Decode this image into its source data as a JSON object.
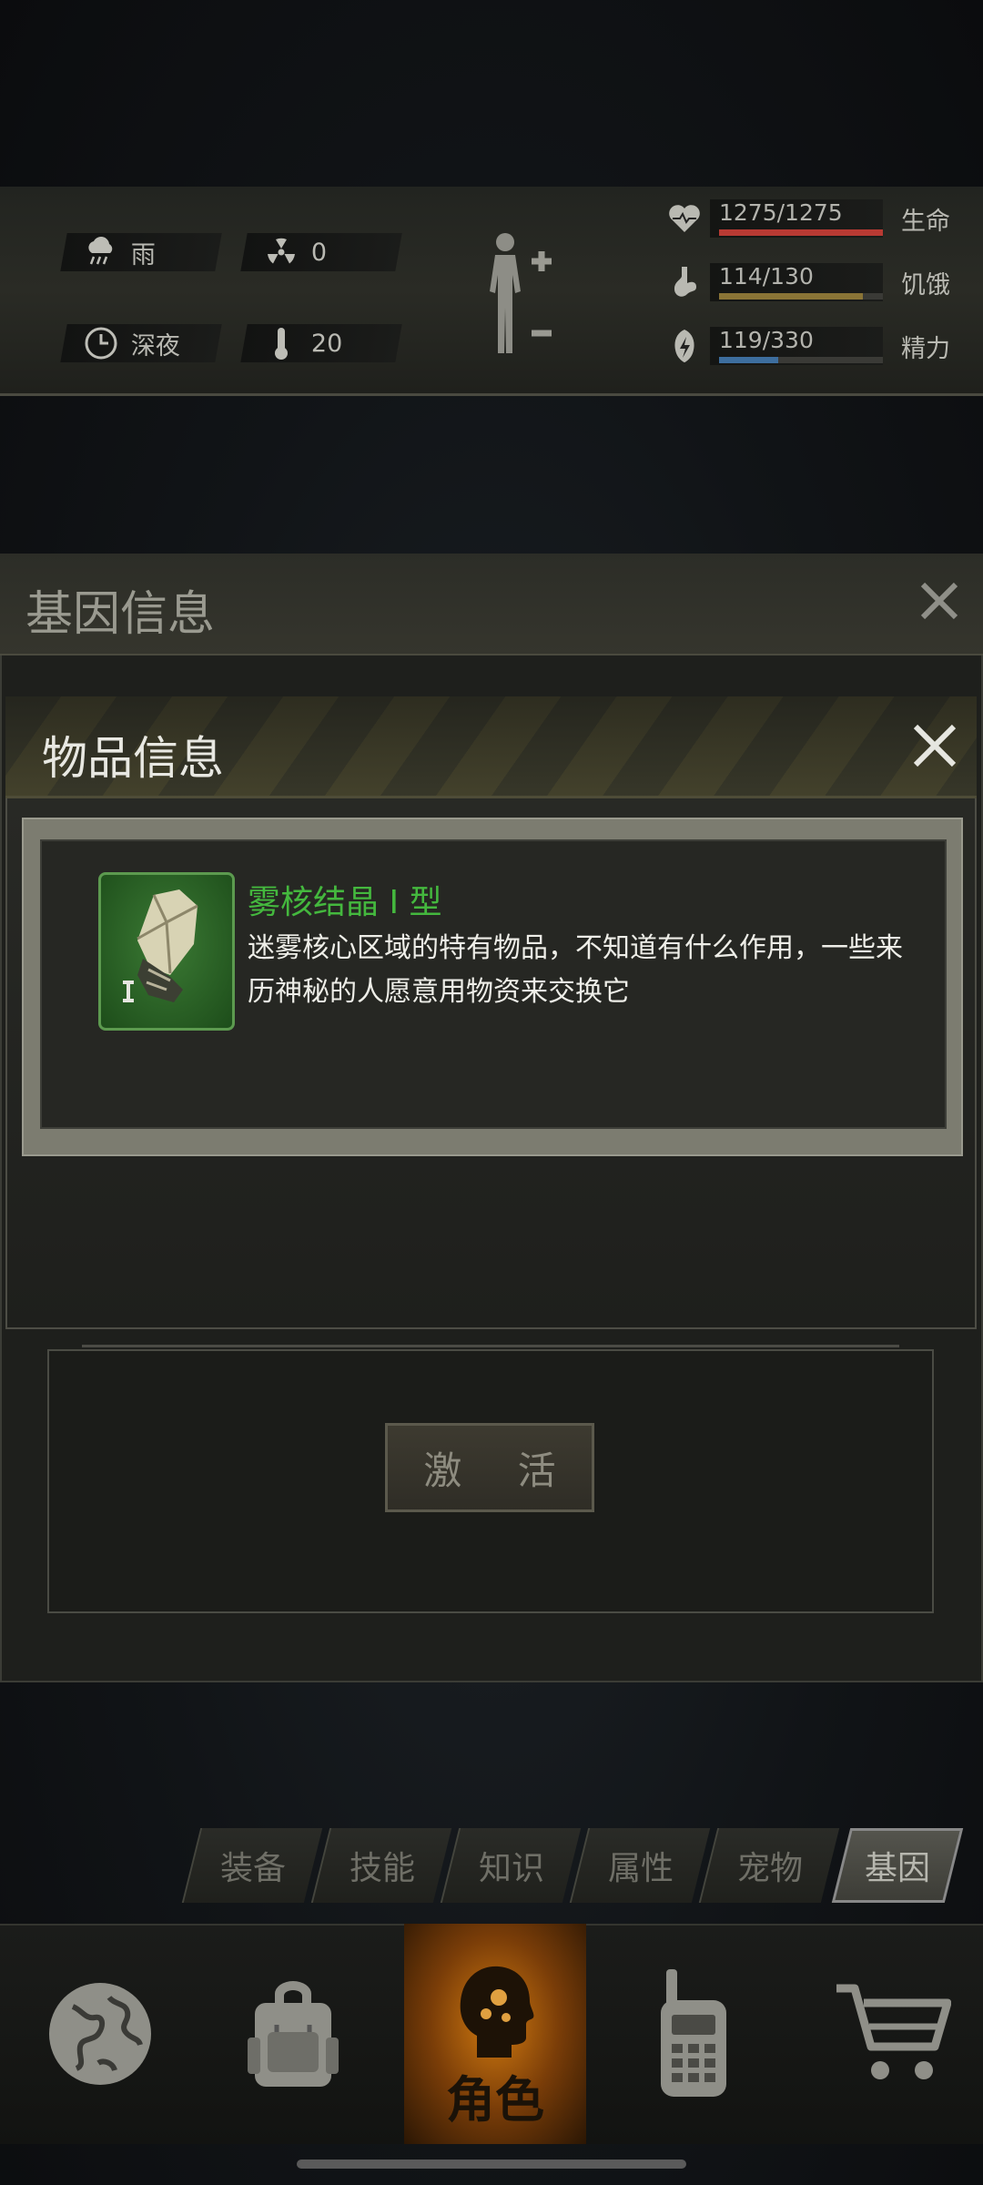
{
  "status": {
    "weather": {
      "icon": "rain-cloud-icon",
      "text": "雨"
    },
    "radiation": {
      "icon": "radiation-icon",
      "text": "0"
    },
    "time": {
      "icon": "clock-icon",
      "text": "深夜"
    },
    "temperature": {
      "icon": "thermometer-icon",
      "text": "20"
    },
    "bars": [
      {
        "icon": "heart-icon",
        "value": "1275/1275",
        "label": "生命",
        "fraction": 1.0,
        "color": "#b83a33"
      },
      {
        "icon": "stomach-icon",
        "value": "114/130",
        "label": "饥饿",
        "fraction": 0.877,
        "color": "#8a7436"
      },
      {
        "icon": "energy-icon",
        "value": "119/330",
        "label": "精力",
        "fraction": 0.36,
        "color": "#3d6e9e"
      }
    ]
  },
  "gene_panel": {
    "title": "基因信息",
    "activate_label": "激 活"
  },
  "item_modal": {
    "title": "物品信息",
    "item_name": "雾核结晶 I 型",
    "item_desc": "迷雾核心区域的特有物品，不知道有什么作用，一些来历神秘的人愿意用物资来交换它"
  },
  "tabs": [
    {
      "label": "装备",
      "active": false
    },
    {
      "label": "技能",
      "active": false
    },
    {
      "label": "知识",
      "active": false
    },
    {
      "label": "属性",
      "active": false
    },
    {
      "label": "宠物",
      "active": false
    },
    {
      "label": "基因",
      "active": true
    }
  ],
  "nav": {
    "items": [
      {
        "icon": "globe-icon"
      },
      {
        "icon": "backpack-icon"
      },
      {
        "icon": "character-icon",
        "label": "角色",
        "active": true
      },
      {
        "icon": "walkie-talkie-icon"
      },
      {
        "icon": "shopping-cart-icon"
      }
    ]
  },
  "colors": {
    "accent_green": "#44b83e",
    "active_orange": "#d17a10"
  }
}
